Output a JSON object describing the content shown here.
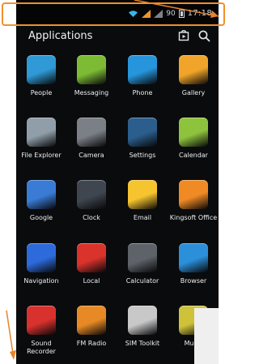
{
  "status_bar": {
    "battery_text": "90",
    "time": "17:18"
  },
  "header": {
    "title": "Applications",
    "icons": [
      "store-icon",
      "search-icon"
    ]
  },
  "apps": [
    {
      "label": "People",
      "icon": "people-icon",
      "color": "#2f9ad6"
    },
    {
      "label": "Messaging",
      "icon": "messaging-icon",
      "color": "#7dbb34"
    },
    {
      "label": "Phone",
      "icon": "phone-icon",
      "color": "#2795dc"
    },
    {
      "label": "Gallery",
      "icon": "gallery-icon",
      "color": "#f0a42a"
    },
    {
      "label": "File Explorer",
      "icon": "file-explorer-icon",
      "color": "#8f9ea8"
    },
    {
      "label": "Camera",
      "icon": "camera-icon",
      "color": "#7b7f86"
    },
    {
      "label": "Settings",
      "icon": "settings-icon",
      "color": "#2b5e8d"
    },
    {
      "label": "Calendar",
      "icon": "calendar-icon",
      "color": "#8ec33e"
    },
    {
      "label": "Google",
      "icon": "google-icon",
      "color": "#3a7bd5"
    },
    {
      "label": "Clock",
      "icon": "clock-icon",
      "color": "#3f4650"
    },
    {
      "label": "Email",
      "icon": "email-icon",
      "color": "#f6c42f"
    },
    {
      "label": "Kingsoft Office",
      "icon": "kingsoft-office-icon",
      "color": "#f08a24"
    },
    {
      "label": "Navigation",
      "icon": "navigation-icon",
      "color": "#2d6bdc"
    },
    {
      "label": "Local",
      "icon": "local-icon",
      "color": "#d9332b"
    },
    {
      "label": "Calculator",
      "icon": "calculator-icon",
      "color": "#5d6369"
    },
    {
      "label": "Browser",
      "icon": "browser-icon",
      "color": "#2c8fda"
    },
    {
      "label": "Sound\nRecorder",
      "icon": "sound-recorder-icon",
      "color": "#d9312e"
    },
    {
      "label": "FM Radio",
      "icon": "fm-radio-icon",
      "color": "#e78a25"
    },
    {
      "label": "SIM Toolkit",
      "icon": "sim-toolkit-icon",
      "color": "#c8c8c8"
    },
    {
      "label": "Music",
      "icon": "music-icon",
      "color": "#cfc23b"
    }
  ]
}
